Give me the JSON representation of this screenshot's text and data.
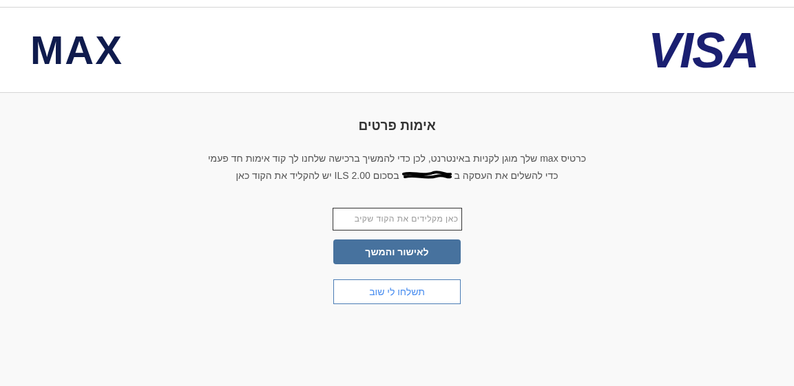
{
  "header": {
    "left_logo": "MAX",
    "right_logo": "VISA"
  },
  "title": "אימות פרטים",
  "message": {
    "line_1": "כרטיס max שלך מוגן לקניות באינטרנט, לכן כדי להמשיך ברכישה שלחנו לך קוד אימות חד פעמי",
    "line_2_before": "כדי להשלים את העסקה ב",
    "line_2_after": "בסכום 2.00 ILS יש להקליד את הקוד כאן"
  },
  "code_field": {
    "placeholder": "כאן מקלידים את הקוד שקיב"
  },
  "buttons": [
    {
      "kind": "primary",
      "label": "לאישור והמשך"
    },
    {
      "kind": "outline",
      "label": "תשלחו לי שוב"
    }
  ]
}
